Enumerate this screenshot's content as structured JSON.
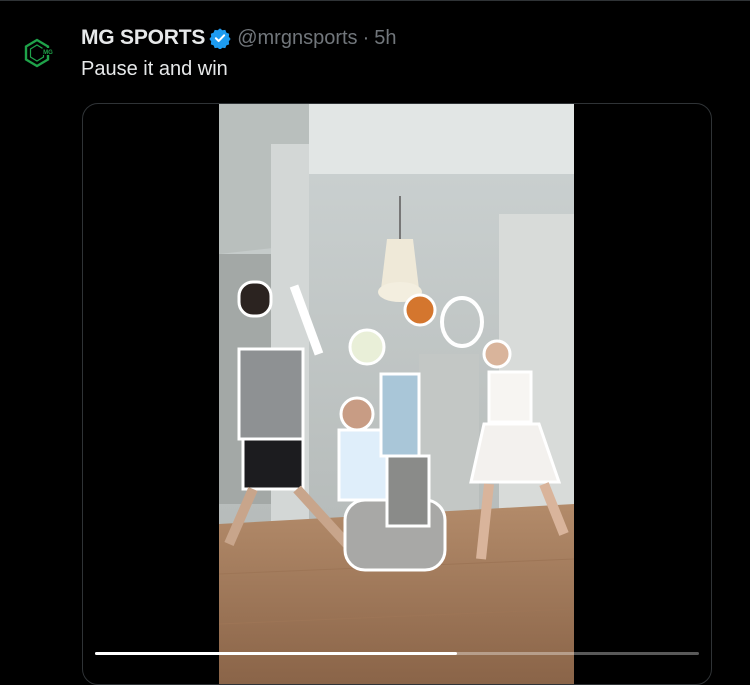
{
  "tweet": {
    "author_name": "MG SPORTS",
    "verified": true,
    "handle": "@mrgnsports",
    "separator": "·",
    "time": "5h",
    "text": "Pause it and win",
    "avatar_icon": "mg-sports-logo-icon",
    "verified_icon": "verified-badge-icon"
  },
  "media": {
    "type": "video",
    "progress": 0.6,
    "colors": {
      "accent_verified": "#1d9bf0",
      "logo_green": "#1fa34a"
    }
  }
}
